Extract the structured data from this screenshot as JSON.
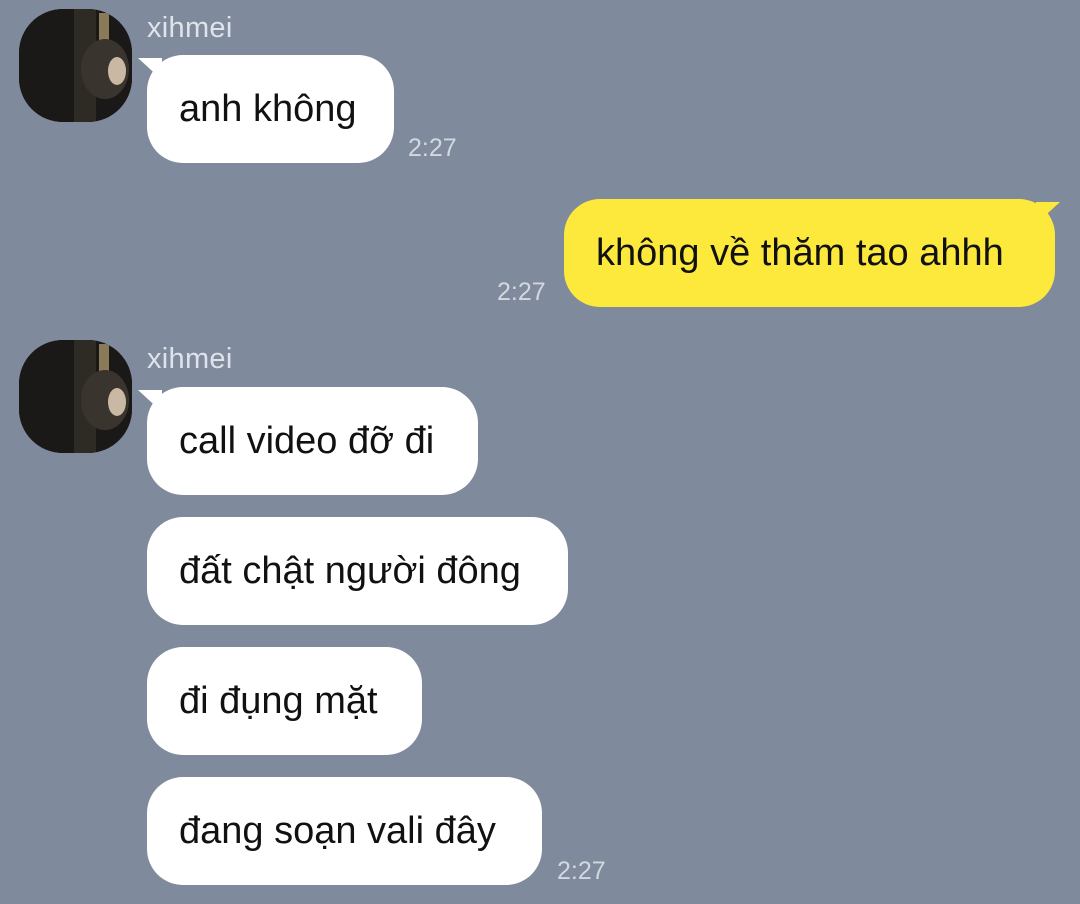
{
  "chat": {
    "messages": [
      {
        "sender": "xihmei",
        "text": "anh không",
        "time": "2:27"
      },
      {
        "text": "không về thăm tao ahhh",
        "time": "2:27"
      },
      {
        "sender": "xihmei",
        "text": "call video đỡ đi"
      },
      {
        "text": "đất chật người đông"
      },
      {
        "text": "đi đụng mặt"
      },
      {
        "text": "đang soạn vali đây",
        "time": "2:27"
      }
    ]
  },
  "colors": {
    "background": "#7f8a9d",
    "incoming_bubble": "#ffffff",
    "outgoing_bubble": "#fde93b"
  }
}
